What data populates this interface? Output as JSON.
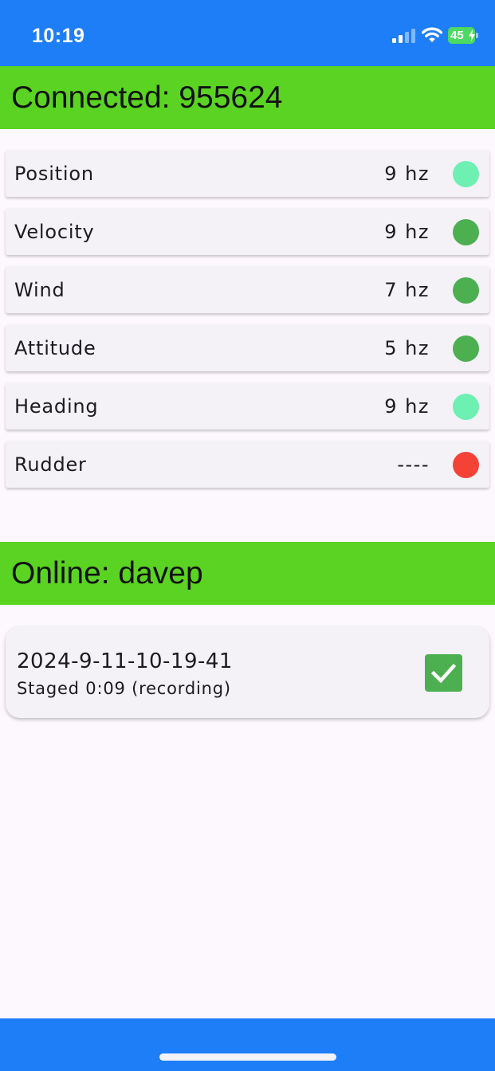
{
  "status_bar": {
    "time": "10:19",
    "battery_percent": "45",
    "icons": [
      "signal-icon",
      "wifi-icon",
      "battery-icon",
      "charging-bolt-icon"
    ],
    "background_color": "#1e7ef7"
  },
  "connected": {
    "title": "Connected: 955624",
    "header_color": "#5ad322"
  },
  "sensors": [
    {
      "label": "Position",
      "rate": "9 hz",
      "status": "active",
      "dot_color": "#6ef0b2"
    },
    {
      "label": "Velocity",
      "rate": "9 hz",
      "status": "good",
      "dot_color": "#4caf50"
    },
    {
      "label": "Wind",
      "rate": "7 hz",
      "status": "good",
      "dot_color": "#4caf50"
    },
    {
      "label": "Attitude",
      "rate": "5 hz",
      "status": "good",
      "dot_color": "#4caf50"
    },
    {
      "label": "Heading",
      "rate": "9 hz",
      "status": "active",
      "dot_color": "#6ef0b2"
    },
    {
      "label": "Rudder",
      "rate": "----",
      "status": "error",
      "dot_color": "#f44336"
    }
  ],
  "online": {
    "title": "Online: davep",
    "header_color": "#5ad322"
  },
  "recording": {
    "title": "2024-9-11-10-19-41",
    "subtitle": "Staged 0:09 (recording)",
    "checked": true,
    "checkbox_color": "#4caf50"
  },
  "bottom_bar": {
    "background_color": "#1e7ef7"
  }
}
